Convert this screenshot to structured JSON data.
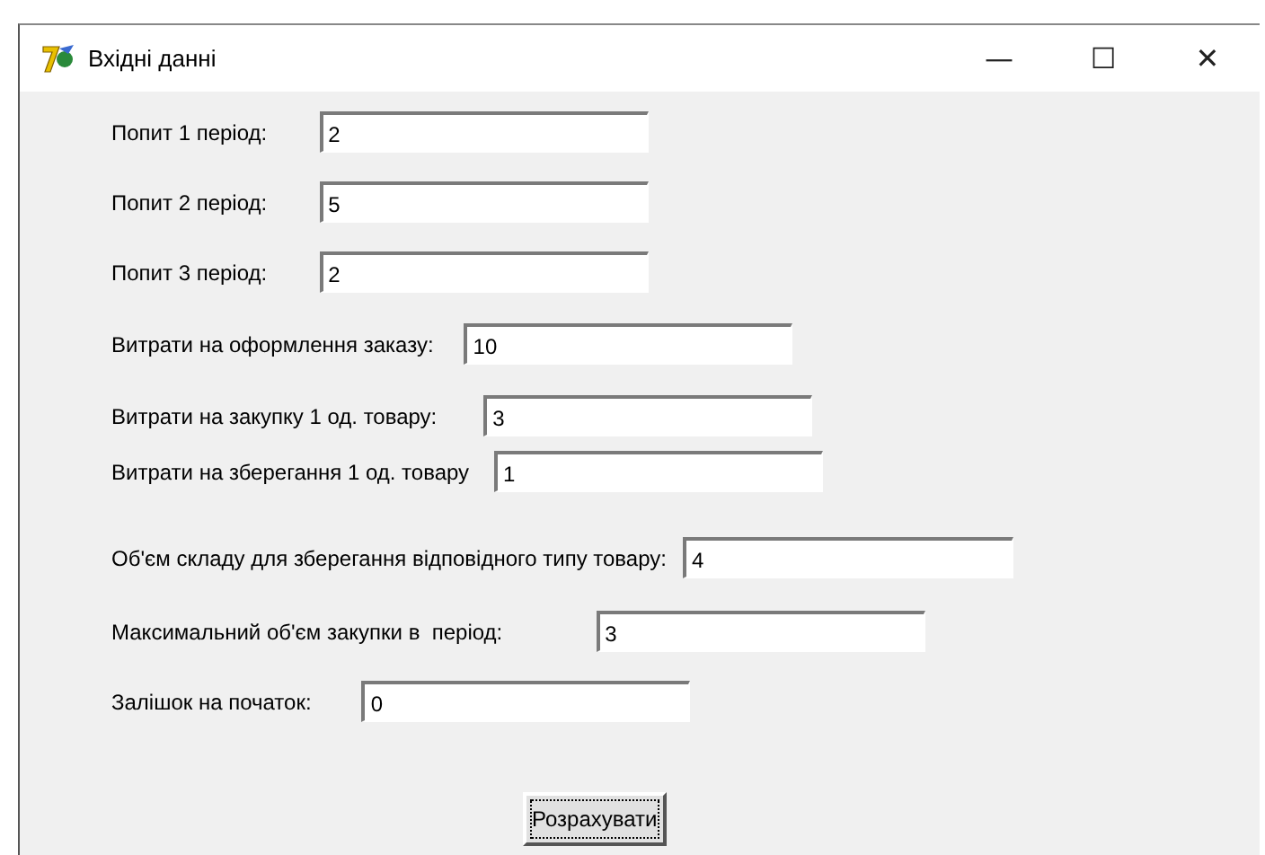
{
  "window": {
    "title": "Вхідні данні",
    "controls": [
      "—",
      "☐",
      "✕"
    ]
  },
  "fields": [
    {
      "label": "Попит 1 період:",
      "value": "2"
    },
    {
      "label": "Попит 2 період:",
      "value": "5"
    },
    {
      "label": "Попит 3 період:",
      "value": "2"
    },
    {
      "label": "Витрати на оформлення заказу:",
      "value": "10"
    },
    {
      "label": "Витрати на закупку 1 од. товару:",
      "value": "3"
    },
    {
      "label": "Витрати на зберегання 1 од. товару",
      "value": "1"
    },
    {
      "label": "Об'єм складу для зберегання відповідного типу товару:",
      "value": "4"
    },
    {
      "label": "Максимальний об'єм закупки в  період:",
      "value": "3"
    },
    {
      "label": "Залішок на початок:",
      "value": "0"
    }
  ],
  "button": {
    "label": "Розрахувати"
  }
}
